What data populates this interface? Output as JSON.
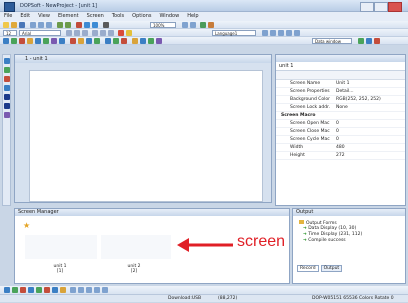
{
  "window": {
    "title": "DOPSoft - NewProject - [unit 1]"
  },
  "menu": [
    "File",
    "Edit",
    "View",
    "Element",
    "Screen",
    "Tools",
    "Options",
    "Window",
    "Help"
  ],
  "toolbar": {
    "zoom": "100%",
    "font": "Arial",
    "language": "Language1",
    "data_window": "Data window"
  },
  "editor": {
    "tab_label": "1 - unit 1"
  },
  "properties": {
    "selected": "unit 1",
    "rows": [
      {
        "k": "Screen Name",
        "v": "Unit 1"
      },
      {
        "k": "Screen Properties",
        "v": "Detail..."
      },
      {
        "k": "Background Color",
        "v": "RGB(252, 252, 252)"
      },
      {
        "k": "Screen Lock addr.",
        "v": "None"
      },
      {
        "k": "Screen Macro",
        "v": "",
        "cat": true
      },
      {
        "k": "Screen Open Mac",
        "v": "0"
      },
      {
        "k": "Screen Close Mac",
        "v": "0"
      },
      {
        "k": "Screen Cycle Mac",
        "v": "0"
      },
      {
        "k": "Width",
        "v": "480"
      },
      {
        "k": "Height",
        "v": "272"
      }
    ]
  },
  "screen_manager": {
    "title": "Screen Manager",
    "screens": [
      {
        "name": "unit 1",
        "num": "[1]"
      },
      {
        "name": "unit 2",
        "num": "[2]"
      }
    ],
    "annotation": "screen"
  },
  "output": {
    "title": "Output",
    "root": "Output Forms",
    "items": [
      "Data Display (10, 30)",
      "Time Display (231, 112)",
      "Compile success"
    ],
    "tabs": [
      "Record",
      "Output"
    ]
  },
  "status": {
    "port": "Download:USB",
    "coords": "(88,272)",
    "model": "DOP-W05151 65536 Colors Rotate 0"
  }
}
